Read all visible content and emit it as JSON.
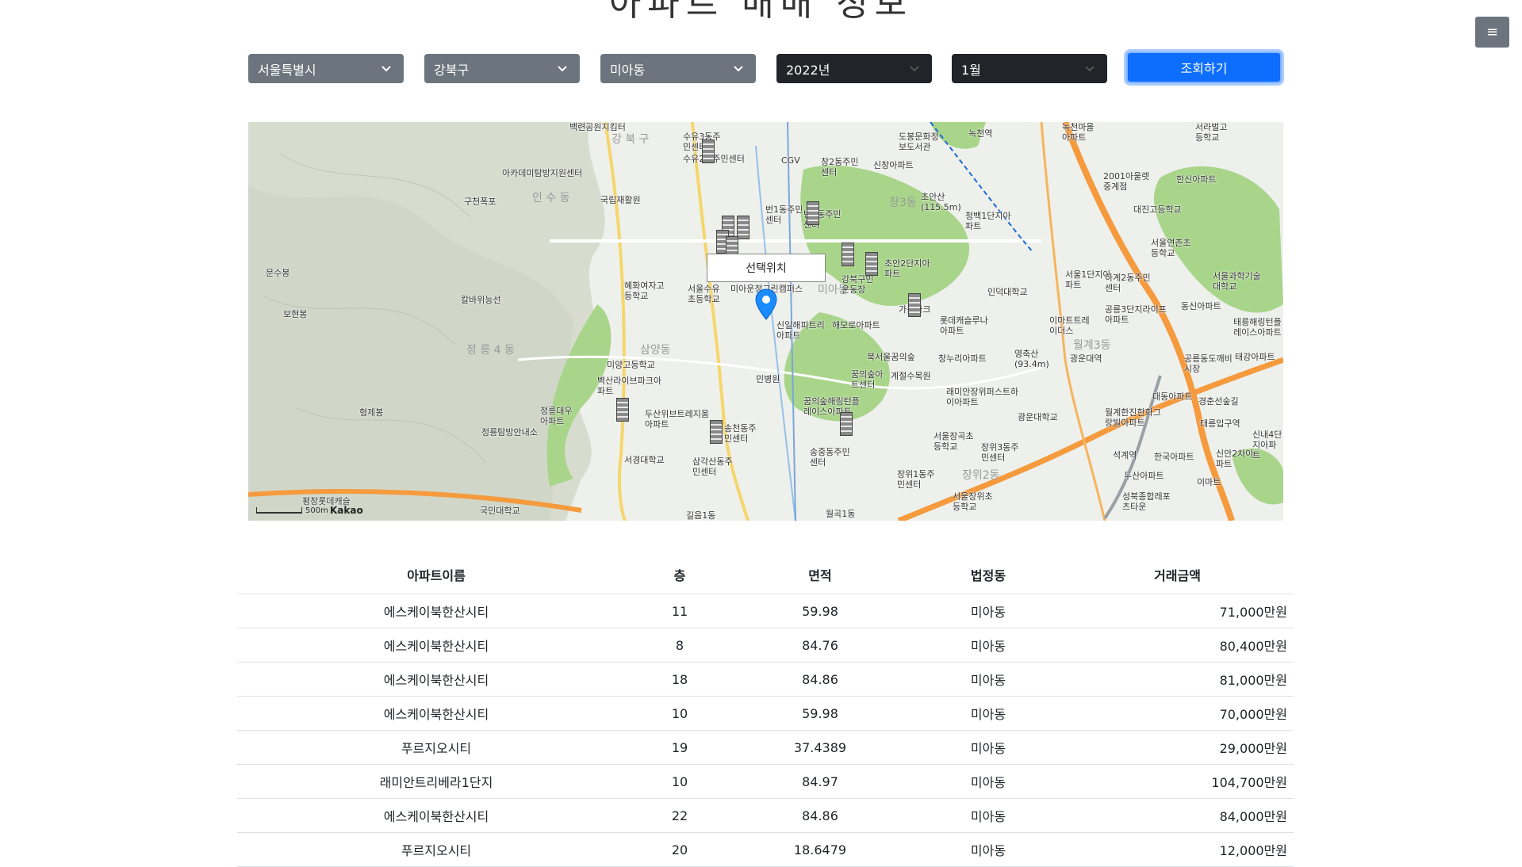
{
  "page": {
    "title": "아파트 매매 정보"
  },
  "menu": {
    "icon": "hamburger-icon",
    "glyph": "≡"
  },
  "filters": {
    "city": "서울특별시",
    "district": "강북구",
    "dong": "미아동",
    "year": "2022년",
    "month": "1월",
    "search_label": "조회하기"
  },
  "colors": {
    "select_gray": "#6c757d",
    "select_dark": "#212529",
    "primary": "#0d6efd",
    "marker": "#1a8cff",
    "park": "#a8d58a",
    "highway": "#f59a3d"
  },
  "map": {
    "info_window": "선택위치",
    "logo": "Kakao",
    "scale": "500m",
    "labels": {
      "l1": "백련공원지킴터",
      "l2": "강 북 구",
      "l3": "아카데미탐방지원센터",
      "l4": "구천폭포",
      "l5": "국립재활원",
      "l6": "인 수 동",
      "l7": "문수봉",
      "l8": "보현봉",
      "l9": "칼바위능선",
      "l10": "형제봉",
      "l11": "정릉탐방안내소",
      "l12": "정 릉 4 동",
      "l13": "정릉대우아파트",
      "l14": "벽산라이브파크아파트",
      "l15": "미양고등학교",
      "l16": "혜화여자고등학교",
      "l17": "서울수유초등학교",
      "l18": "미아운정그린캠퍼스",
      "l19": "민병원",
      "l20": "신일해피트리아파트",
      "l21": "해모로아파트",
      "l22": "두산위브트레지움아파트",
      "l23": "송천동주민센터",
      "l24": "삼각산동주민센터",
      "l25": "서경대학교",
      "l26": "길음1동",
      "l27": "송중동주민센터",
      "l28": "꿈의숲해링턴플레이스아파트",
      "l29": "꿈의숲아트센터",
      "l30": "번1동주민센터",
      "l31": "번2동주민센터",
      "l32": "수유3동주민센터",
      "l33": "창2동주민센터",
      "l34": "신창아파트",
      "l35": "도봉문화정보도서관",
      "l36": "초안산(115.5m)",
      "l37": "청백1단지아파트",
      "l38": "초안2단지아파트",
      "l39": "강북구민운동장",
      "l40": "가든파크",
      "l41": "북서울꿈의숲",
      "l42": "계절수목원",
      "l43": "롯데캐슬루나아파트",
      "l44": "창누리아파트",
      "l45": "인덕대학교",
      "l46": "래미안장위퍼스트하이아파트",
      "l47": "서울장곡초등학교",
      "l48": "장위1동주민센터",
      "l49": "장위3동주민센터",
      "l50": "광운대학교",
      "l51": "영축산(93.4m)",
      "l52": "광운대역",
      "l53": "이마트트레이더스",
      "l54": "서울1단지아파트",
      "l55": "하계2동주민센터",
      "l56": "공릉3단지라이프아파트",
      "l57": "월계한진한화그랑빌아파트",
      "l58": "석계역",
      "l59": "한국아파트",
      "l60": "두산아파트",
      "l61": "신안2차아파트",
      "l62": "태릉입구역",
      "l63": "이마트",
      "l64": "성북종합레포츠타운",
      "l65": "서울장위초등학교",
      "l66": "국민대학교",
      "l67": "평창롯데캐슬",
      "l68": "월곡1동",
      "l69": "녹천역",
      "l70": "수유2동주민센터",
      "l71": "2001아울렛중계점",
      "l72": "대진고등학교",
      "l73": "서울연촌초등학교",
      "l74": "서울과학기술대학교",
      "l75": "동신아파트",
      "l76": "태릉해링턴플레이스아파트",
      "l77": "공릉동도깨비시장",
      "l78": "경춘선숲길",
      "l79": "태강아파트",
      "l80": "신내4단지아파트",
      "l81": "서라벌고등학교",
      "l82": "한신아파트",
      "l83": "녹천마을아파트",
      "l84": "대동아파트",
      "l85": "CGV",
      "l86": "월계3동",
      "l87": "창3동",
      "l88": "장위2동",
      "l89": "삼양동",
      "l90": "미아동"
    }
  },
  "table": {
    "headers": {
      "name": "아파트이름",
      "floor": "층",
      "area": "면적",
      "dong": "법정동",
      "price": "거래금액"
    },
    "rows": [
      {
        "name": "에스케이북한산시티",
        "floor": "11",
        "area": "59.98",
        "dong": "미아동",
        "price": "71,000만원"
      },
      {
        "name": "에스케이북한산시티",
        "floor": "8",
        "area": "84.76",
        "dong": "미아동",
        "price": "80,400만원"
      },
      {
        "name": "에스케이북한산시티",
        "floor": "18",
        "area": "84.86",
        "dong": "미아동",
        "price": "81,000만원"
      },
      {
        "name": "에스케이북한산시티",
        "floor": "10",
        "area": "59.98",
        "dong": "미아동",
        "price": "70,000만원"
      },
      {
        "name": "푸르지오시티",
        "floor": "19",
        "area": "37.4389",
        "dong": "미아동",
        "price": "29,000만원"
      },
      {
        "name": "래미안트리베라1단지",
        "floor": "10",
        "area": "84.97",
        "dong": "미아동",
        "price": "104,700만원"
      },
      {
        "name": "에스케이북한산시티",
        "floor": "22",
        "area": "84.86",
        "dong": "미아동",
        "price": "84,000만원"
      },
      {
        "name": "푸르지오시티",
        "floor": "20",
        "area": "18.6479",
        "dong": "미아동",
        "price": "12,000만원"
      }
    ]
  }
}
